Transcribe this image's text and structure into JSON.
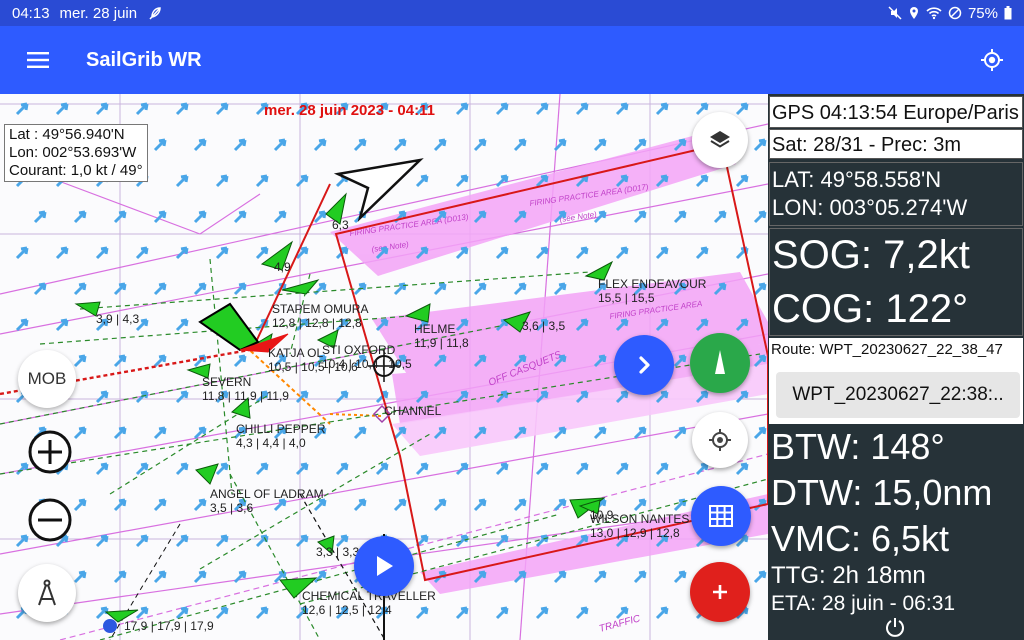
{
  "statusbar": {
    "time": "04:13",
    "date": "mer. 28 juin",
    "battery": "75%"
  },
  "appbar": {
    "title": "SailGrib WR"
  },
  "map": {
    "datetime": "mer. 28 juin 2023 - 04:11",
    "cursor": {
      "lat": "Lat :  49°56.940'N",
      "lon": "Lon: 002°53.693'W",
      "current": "Courant: 1,0 kt / 49°"
    },
    "chart_text": {
      "firing_area_1": "FIRING PRACTICE AREA (D013)",
      "firing_area_2": "FIRING PRACTICE AREA (D017)",
      "firing_area_3": "FIRING PRACTICE AREA",
      "see_note_1": "(see Note)",
      "see_note_2": "(see Note)",
      "off_casquets": "OFF CASQUETS",
      "traffic": "TRAFFIC"
    },
    "vessels": [
      {
        "name": "",
        "speeds": "6,3"
      },
      {
        "name": "",
        "speeds": "4,9"
      },
      {
        "name": "",
        "speeds": "3,9 | 4,3"
      },
      {
        "name": "STAPEM OMURA",
        "speeds": "12,8 | 12,8 | 12,8"
      },
      {
        "name": "KATJA OL",
        "speeds": "10,5 | 10,5 | 10,6"
      },
      {
        "name": "STI OXFORD",
        "speeds": "10,4 | 10,4 | 10,5"
      },
      {
        "name": "HELME",
        "speeds": "11,9 | 11,8"
      },
      {
        "name": "",
        "speeds": "3,6 | 3,5"
      },
      {
        "name": "FLEX ENDEAVOUR",
        "speeds": "15,5 | 15,5"
      },
      {
        "name": "SEVERN",
        "speeds": "11,8 | 11,9 | 11,9"
      },
      {
        "name": "CHANNEL",
        "speeds": ""
      },
      {
        "name": "CHILLI PEPPER",
        "speeds": "4,3 | 4,4 | 4,0"
      },
      {
        "name": "ANGEL OF LADRAM",
        "speeds": "3,5 | 3,6"
      },
      {
        "name": "WILSON NANTES",
        "speeds": "13,0 | 12,9 | 12,8"
      },
      {
        "name": "",
        "speeds": "10,9"
      },
      {
        "name": "",
        "speeds": "3,3 | 3,3"
      },
      {
        "name": "CHEMICAL TRAVELLER",
        "speeds": "12,6 | 12,5 | 12,4"
      },
      {
        "name": "",
        "speeds": "17,9 | 17,9 | 17,9"
      }
    ],
    "mob_label": "MOB"
  },
  "panel": {
    "gps": "GPS 04:13:54 Europe/Paris",
    "sat": "Sat: 28/31 - Prec: 3m",
    "lat": "LAT: 49°58.558'N",
    "lon": "LON: 003°05.274'W",
    "sog": "SOG: 7,2kt",
    "cog": "COG: 122°",
    "route": "Route: WPT_20230627_22_38_47",
    "waypoint": "WPT_20230627_22:38:..",
    "btw": "BTW: 148°",
    "dtw": "DTW: 15,0nm",
    "vmc": "VMC: 6,5kt",
    "ttg": "TTG: 2h 18mn",
    "eta": "ETA: 28 juin - 06:31"
  },
  "colors": {
    "statusbar": "#2a4bd4",
    "appbar": "#2e5bff",
    "panel_bg": "#263238",
    "fab_green": "#2aa84a",
    "fab_red": "#e0201c",
    "firing_area": "#f08cf5",
    "route_box": "#d81818",
    "current_arrow": "#4aa6e8",
    "vessel": "#22cc22"
  }
}
